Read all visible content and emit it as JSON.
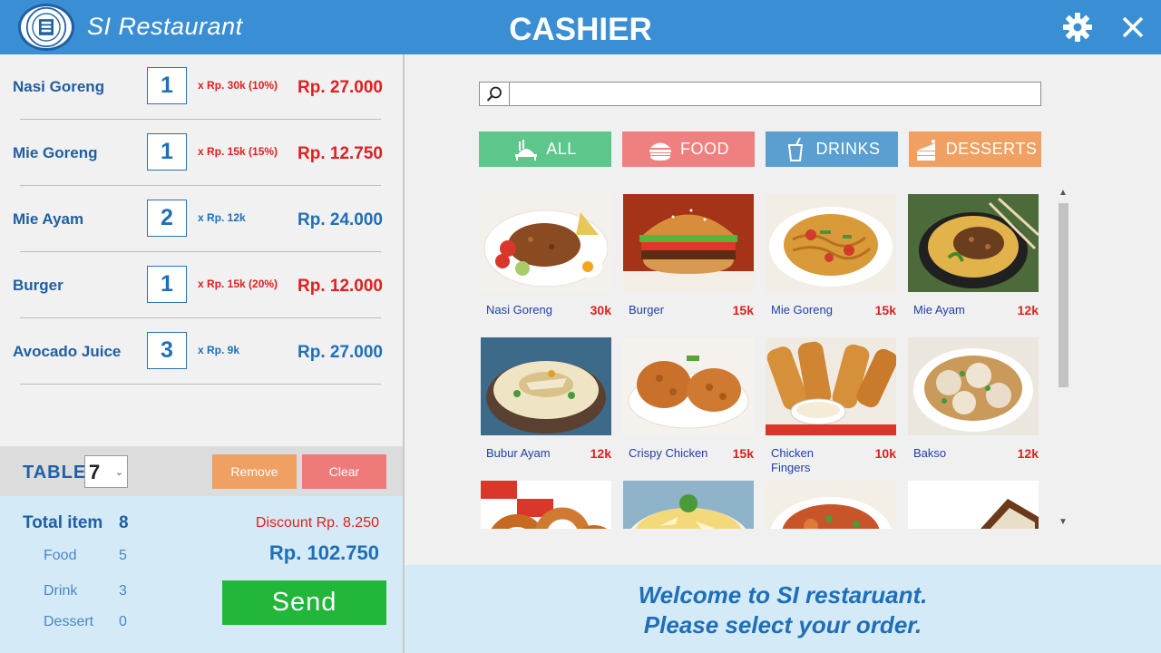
{
  "header": {
    "app_title": "SI Restaurant",
    "screen_title": "CASHIER",
    "settings_icon": "gear-icon",
    "close_icon": "close-icon"
  },
  "orders": [
    {
      "name": "Nasi Goreng",
      "qty": "1",
      "price": "x  Rp. 30k (10%)",
      "total": "Rp. 27.000",
      "discounted": true
    },
    {
      "name": "Mie Goreng",
      "qty": "1",
      "price": "x  Rp. 15k (15%)",
      "total": "Rp. 12.750",
      "discounted": true
    },
    {
      "name": "Mie Ayam",
      "qty": "2",
      "price": "x  Rp. 12k",
      "total": "Rp. 24.000",
      "discounted": false
    },
    {
      "name": "Burger",
      "qty": "1",
      "price": "x  Rp. 15k (20%)",
      "total": "Rp. 12.000",
      "discounted": true
    },
    {
      "name": "Avocado Juice",
      "qty": "3",
      "price": "x  Rp. 9k",
      "total": "Rp. 27.000",
      "discounted": false
    }
  ],
  "table": {
    "label": "TABLE",
    "selected": "7",
    "remove_label": "Remove",
    "clear_label": "Clear"
  },
  "summary": {
    "total_item_label": "Total item",
    "total_item_count": "8",
    "food_label": "Food",
    "food_count": "5",
    "drink_label": "Drink",
    "drink_count": "3",
    "dessert_label": "Dessert",
    "dessert_count": "0",
    "discount": "Discount Rp. 8.250",
    "grand_total": "Rp. 102.750",
    "send_label": "Send"
  },
  "search": {
    "value": "",
    "placeholder": ""
  },
  "categories": [
    {
      "label": "ALL",
      "icon": "meal-tray-icon",
      "color": "#5dc68a"
    },
    {
      "label": "FOOD",
      "icon": "burger-icon",
      "color": "#f08080"
    },
    {
      "label": "DRINKS",
      "icon": "drink-cup-icon",
      "color": "#5a9fd0"
    },
    {
      "label": "DESSERTS",
      "icon": "cake-icon",
      "color": "#f0a062"
    }
  ],
  "menu": [
    {
      "name": "Nasi Goreng",
      "price": "30k"
    },
    {
      "name": "Burger",
      "price": "15k"
    },
    {
      "name": "Mie Goreng",
      "price": "15k"
    },
    {
      "name": "Mie Ayam",
      "price": "12k"
    },
    {
      "name": "Bubur Ayam",
      "price": "12k"
    },
    {
      "name": "Crispy Chicken",
      "price": "15k"
    },
    {
      "name": "Chicken Fingers",
      "price": "10k"
    },
    {
      "name": "Bakso",
      "price": "12k"
    },
    {
      "name": "",
      "price": ""
    },
    {
      "name": "",
      "price": ""
    },
    {
      "name": "",
      "price": ""
    },
    {
      "name": "",
      "price": ""
    }
  ],
  "welcome": {
    "line1": "Welcome to SI restaruant.",
    "line2": "Please select your order."
  },
  "colors": {
    "header_blue": "#3a8fd4",
    "text_blue": "#1f6fb8",
    "red": "#e01f1f",
    "send_green": "#22b63a",
    "panel_light_blue": "#d5eaf7"
  }
}
